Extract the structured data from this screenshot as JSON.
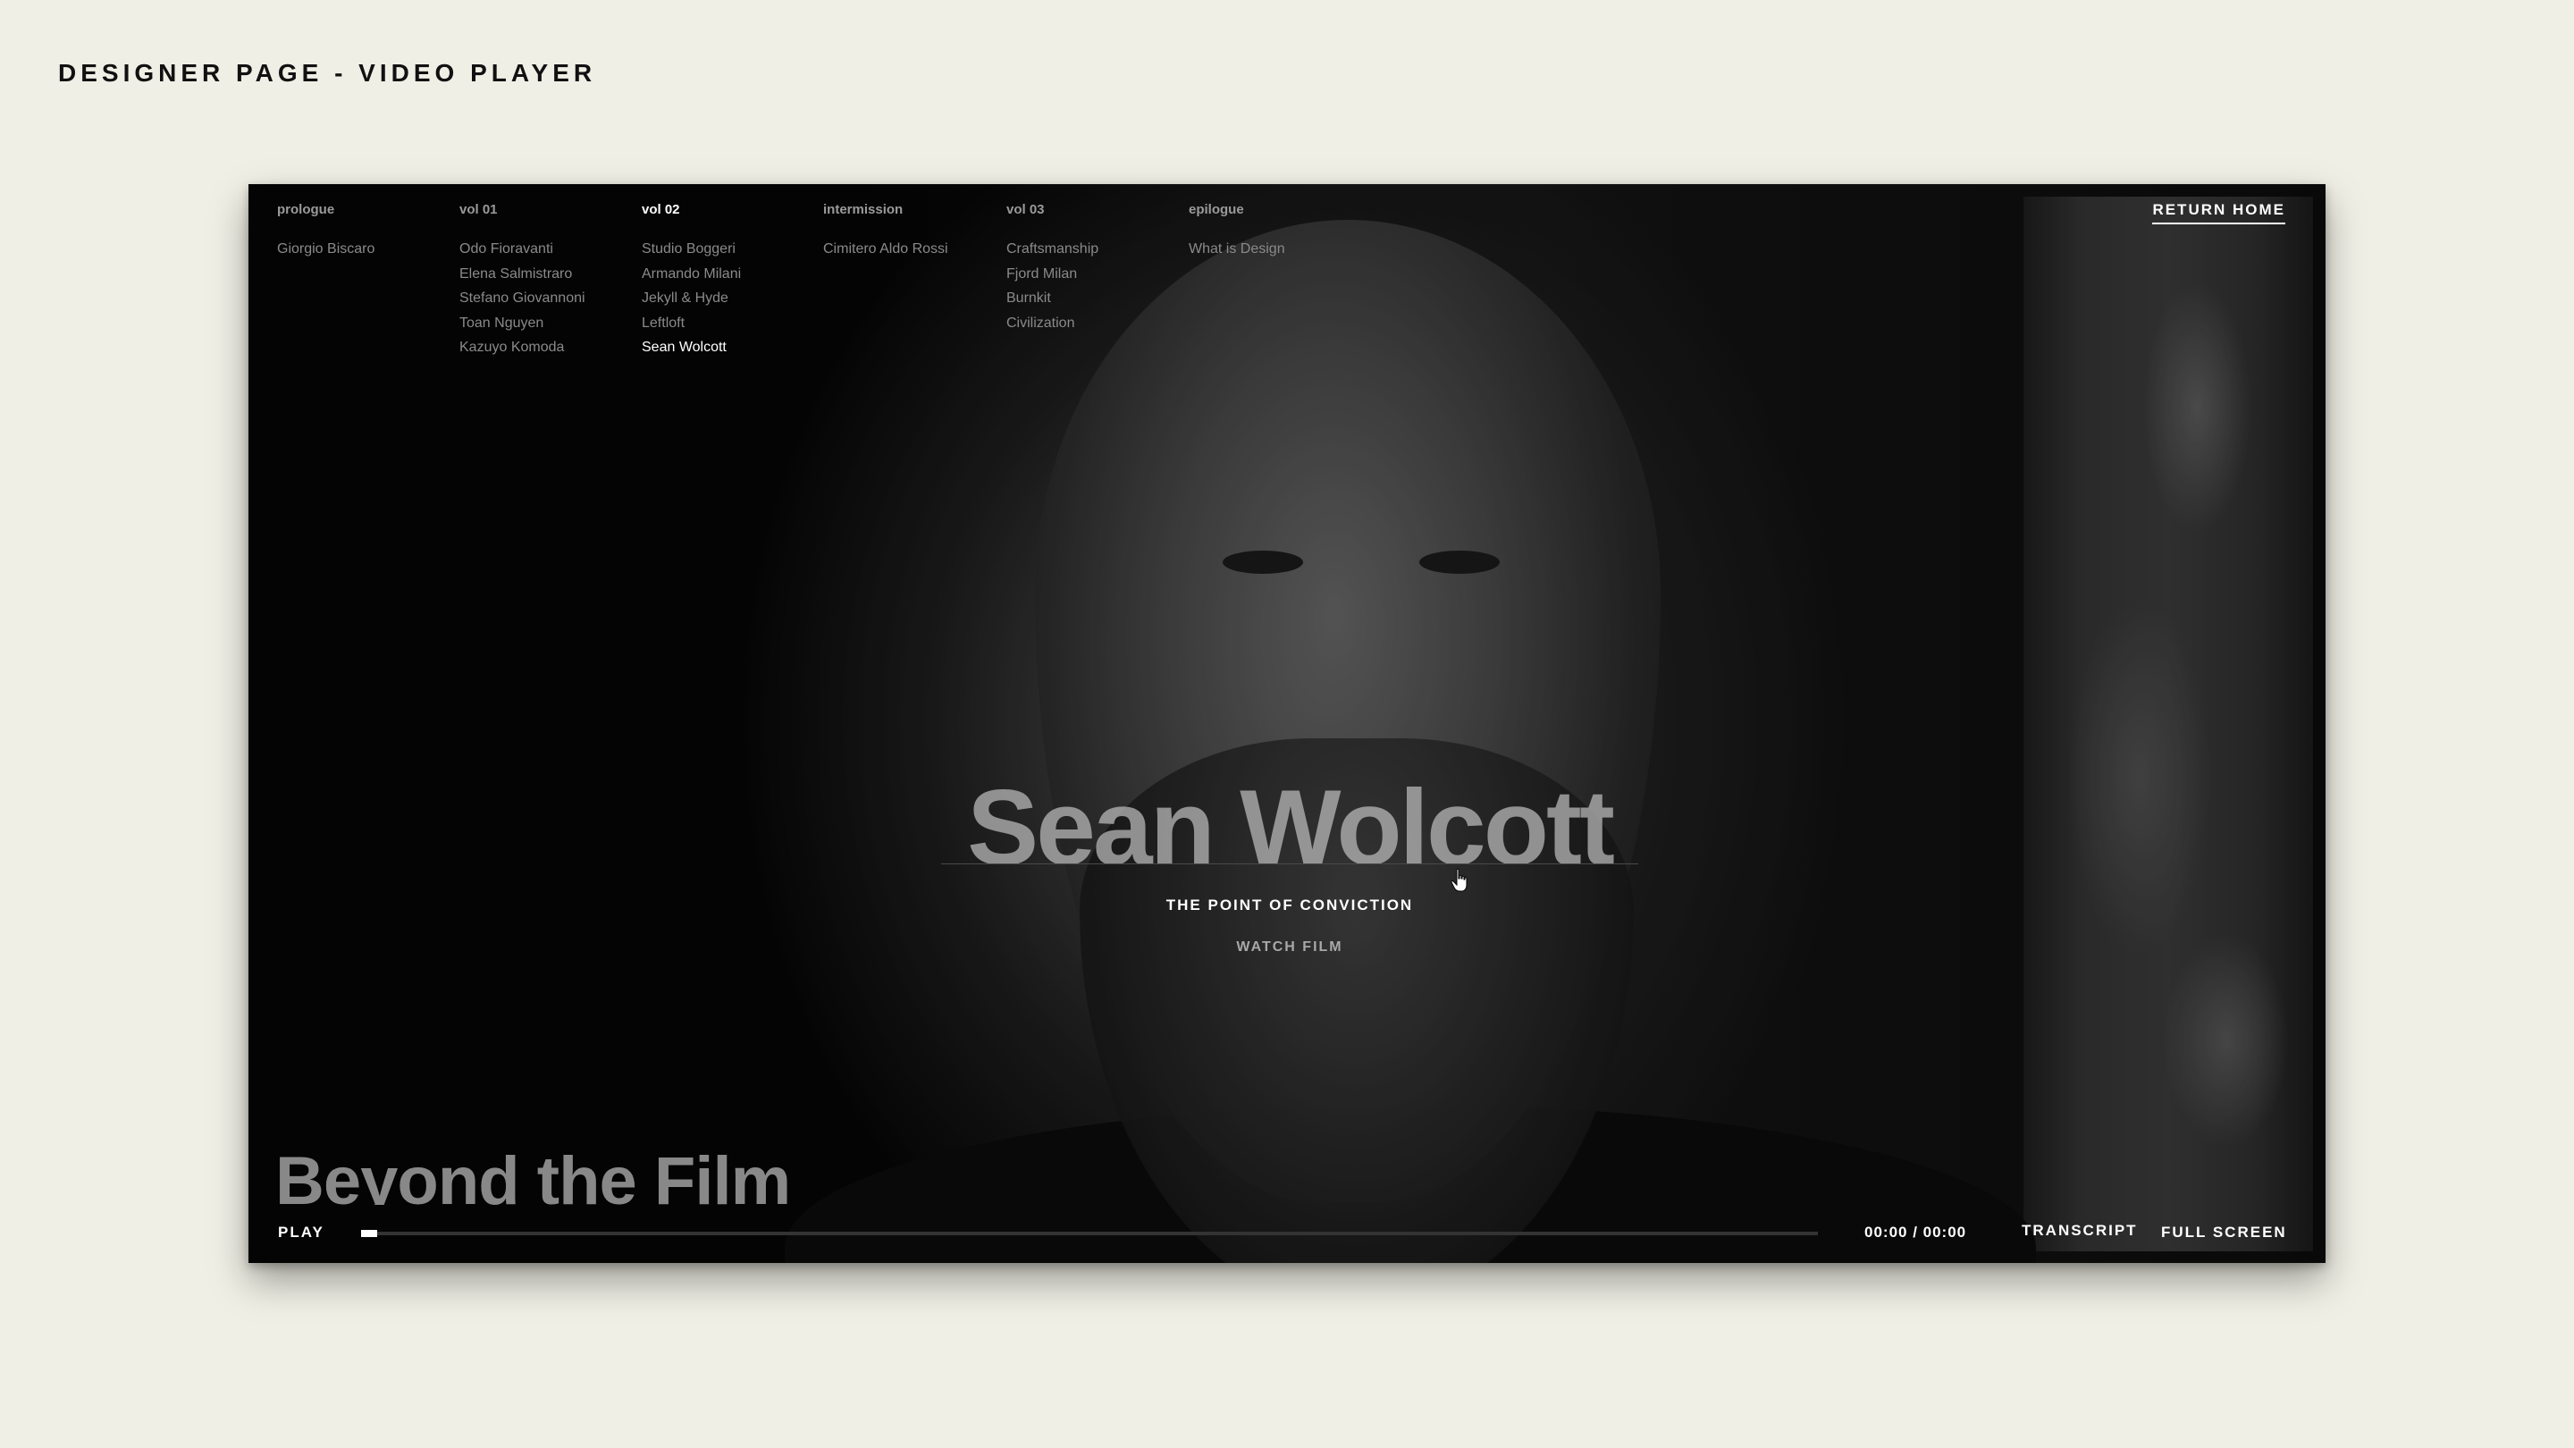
{
  "page_title": "DESIGNER PAGE - VIDEO PLAYER",
  "nav": {
    "return_home": "RETURN HOME",
    "chapters": [
      {
        "heading": "prologue",
        "active": false,
        "items": [
          {
            "label": "Giorgio Biscaro",
            "active": false
          }
        ]
      },
      {
        "heading": "vol 01",
        "active": false,
        "items": [
          {
            "label": "Odo Fioravanti",
            "active": false
          },
          {
            "label": "Elena Salmistraro",
            "active": false
          },
          {
            "label": "Stefano Giovannoni",
            "active": false
          },
          {
            "label": "Toan Nguyen",
            "active": false
          },
          {
            "label": "Kazuyo Komoda",
            "active": false
          }
        ]
      },
      {
        "heading": "vol 02",
        "active": true,
        "items": [
          {
            "label": "Studio Boggeri",
            "active": false
          },
          {
            "label": "Armando Milani",
            "active": false
          },
          {
            "label": "Jekyll & Hyde",
            "active": false
          },
          {
            "label": "Leftloft",
            "active": false
          },
          {
            "label": "Sean Wolcott",
            "active": true
          }
        ]
      },
      {
        "heading": "intermission",
        "active": false,
        "items": [
          {
            "label": "Cimitero Aldo Rossi",
            "active": false
          }
        ]
      },
      {
        "heading": "vol 03",
        "active": false,
        "items": [
          {
            "label": "Craftsmanship",
            "active": false
          },
          {
            "label": "Fjord Milan",
            "active": false
          },
          {
            "label": "Burnkit",
            "active": false
          },
          {
            "label": "Civilization",
            "active": false
          }
        ]
      },
      {
        "heading": "epilogue",
        "active": false,
        "items": [
          {
            "label": "What is Design",
            "active": false
          }
        ]
      }
    ]
  },
  "hero": {
    "name": "Sean Wolcott",
    "subtitle": "THE POINT OF CONVICTION",
    "watch_label": "WATCH FILM"
  },
  "lower_title": "Beyond the Film",
  "controls": {
    "play_label": "PLAY",
    "time": "00:00 / 00:00",
    "progress": 0,
    "transcript_label": "TRANSCRIPT",
    "fullscreen_label": "FULL SCREEN"
  },
  "colors": {
    "page_background": "#efefe5",
    "player_background": "#060606",
    "active_text": "#ffffff",
    "inactive_text": "#8a8a8a"
  },
  "icons": {
    "cursor": "hand-pointer-icon"
  }
}
